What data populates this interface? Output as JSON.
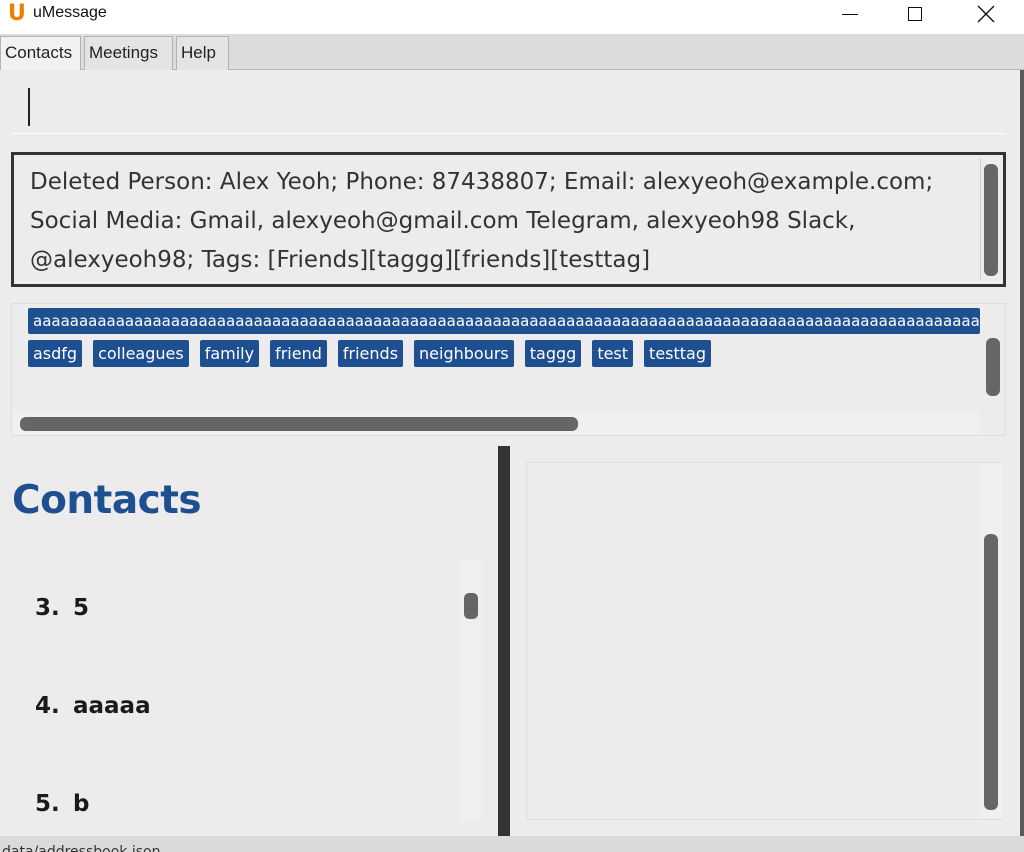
{
  "window": {
    "title": "uMessage",
    "icon_glyph": "U",
    "icon": "umessage-logo-icon"
  },
  "tabs": [
    {
      "label": "Contacts",
      "active": true
    },
    {
      "label": "Meetings",
      "active": false
    },
    {
      "label": "Help",
      "active": false
    }
  ],
  "command_box": {
    "value": ""
  },
  "result": {
    "text": "Deleted Person: Alex Yeoh; Phone: 87438807; Email: alexyeoh@example.com; Social Media: Gmail, alexyeoh@gmail.com Telegram, alexyeoh98 Slack, @alexyeoh98; Tags: [Friends][taggg][friends][testtag]"
  },
  "tags": {
    "long_tag": "aaaaaaaaaaaaaaaaaaaaaaaaaaaaaaaaaaaaaaaaaaaaaaaaaaaaaaaaaaaaaaaaaaaaaaaaaaaaaaaaaaaaaaaaaaaaaaaaaaaaaaaaa",
    "items": [
      "asdfg",
      "colleagues",
      "family",
      "friend",
      "friends",
      "neighbours",
      "taggg",
      "test",
      "testtag"
    ]
  },
  "contacts": {
    "heading": "Contacts",
    "items": [
      {
        "number": "3.",
        "name": "5"
      },
      {
        "number": "4.",
        "name": "aaaaa"
      },
      {
        "number": "5.",
        "name": "b"
      }
    ]
  },
  "statusbar": {
    "text": "data/addressbook.json"
  },
  "colors": {
    "accent": "#1d4f91",
    "logo": "#f07c00"
  }
}
